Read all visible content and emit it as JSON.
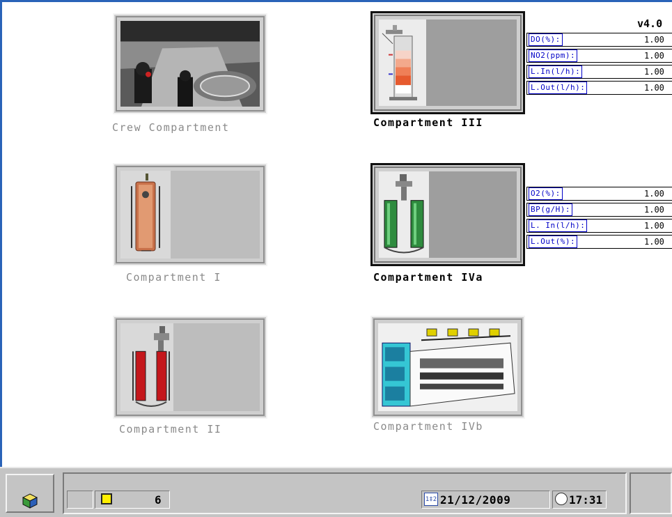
{
  "app": {
    "version": "v4.0"
  },
  "tiles": {
    "crew": {
      "caption": "Crew Compartment"
    },
    "c3": {
      "caption": "Compartment III"
    },
    "c1": {
      "caption": "Compartment I"
    },
    "c4a": {
      "caption": "Compartment IVa"
    },
    "c2": {
      "caption": "Compartment II"
    },
    "c4b": {
      "caption": "Compartment IVb"
    }
  },
  "c3_readouts": [
    {
      "label": "DO(%):",
      "value": "1.00"
    },
    {
      "label": "NO2(ppm):",
      "value": "1.00"
    },
    {
      "label": "L.In(l/h):",
      "value": "1.00"
    },
    {
      "label": "L.Out(l/h):",
      "value": "1.00"
    }
  ],
  "c4a_readouts": [
    {
      "label": "O2(%):",
      "value": "1.00"
    },
    {
      "label": "BP(g/H):",
      "value": "1.00"
    },
    {
      "label": "L. In(l/h):",
      "value": "1.00"
    },
    {
      "label": "L.Out(%):",
      "value": "1.00"
    }
  ],
  "taskbar": {
    "notification_count": "6",
    "date": "21/12/2009",
    "time": "17:31",
    "date_icon_text": "1‡2"
  },
  "colors": {
    "accent": "#2a63b8",
    "label_blue": "#0000c8",
    "note_yellow": "#ffef00"
  }
}
